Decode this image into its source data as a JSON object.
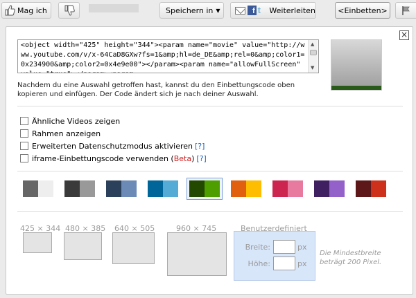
{
  "toolbar": {
    "like_label": "Mag ich",
    "save_label": "Speichern in",
    "share_label": "Weiterleiten",
    "embed_label": "<Einbetten>",
    "rating_fraction": 0.0
  },
  "embed": {
    "code": "<object width=\"425\" height=\"344\"><param name=\"movie\" value=\"http://www.youtube.com/v/x-64CaD8GXw?fs=1&amp;hl=de_DE&amp;rel=0&amp;color1=0x234900&amp;color2=0x4e9e00\"></param><param name=\"allowFullScreen\" value=\"true\"></param><param",
    "hint": "Nachdem du eine Auswahl getroffen hast, kannst du den Einbettungscode oben kopieren und einfügen. Der Code ändert sich je nach deiner Auswahl.",
    "close_glyph": "×"
  },
  "options": [
    {
      "label": "Ähnliche Videos zeigen",
      "checked": false
    },
    {
      "label": "Rahmen anzeigen",
      "checked": false
    },
    {
      "label": "Erweiterten Datenschutzmodus aktivieren",
      "checked": false,
      "help": "[?]"
    },
    {
      "label": "iframe-Einbettungscode verwenden (",
      "beta": "Beta",
      "after": ")",
      "checked": false,
      "help": "[?]"
    }
  ],
  "colors": [
    {
      "a": "#666666",
      "b": "#eeeeee"
    },
    {
      "a": "#3a3a3a",
      "b": "#999999"
    },
    {
      "a": "#2b405b",
      "b": "#6b8ab6"
    },
    {
      "a": "#006699",
      "b": "#54abd6"
    },
    {
      "a": "#234900",
      "b": "#4e9e00",
      "selected": true
    },
    {
      "a": "#e1600f",
      "b": "#febd01"
    },
    {
      "a": "#cc2550",
      "b": "#e87a9f"
    },
    {
      "a": "#402061",
      "b": "#9461ca"
    },
    {
      "a": "#5d1719",
      "b": "#cd311b"
    }
  ],
  "sizes": [
    {
      "label": "425 × 344"
    },
    {
      "label": "480 × 385"
    },
    {
      "label": "640 × 505"
    },
    {
      "label": "960 × 745"
    }
  ],
  "custom": {
    "title": "Benutzerdefiniert",
    "width_label": "Breite:",
    "height_label": "Höhe:",
    "unit": "px",
    "width_value": "",
    "height_value": "",
    "note": "Die Mindestbreite beträgt 200 Pixel."
  }
}
